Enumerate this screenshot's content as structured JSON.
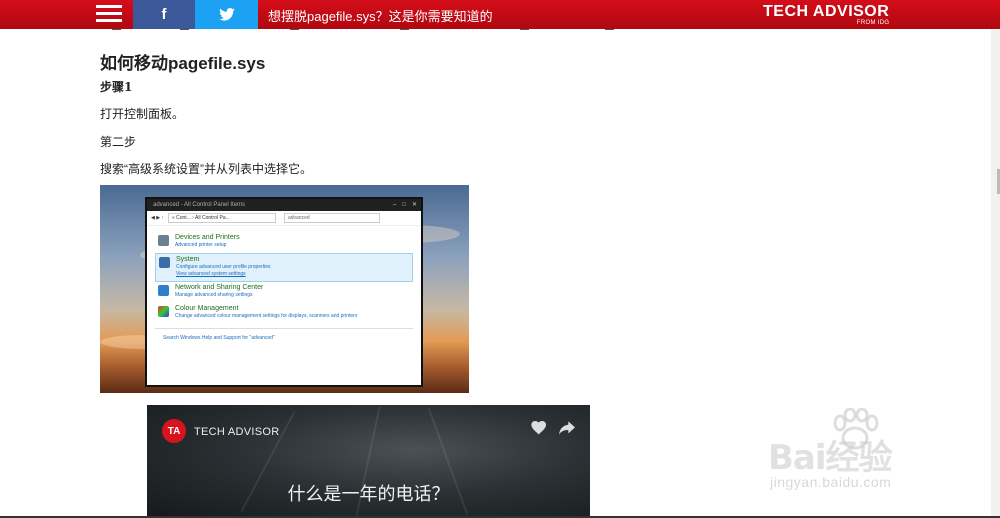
{
  "topbar": {
    "title": "想摆脱pagefile.sys？这是你需要知道的",
    "logo": "TECH ADVISOR",
    "logo_sub": "FROM IDG",
    "facebook_glyph": "f",
    "colors": {
      "bar": "#c90b14",
      "facebook": "#3b5998",
      "twitter": "#1da1f2"
    }
  },
  "article": {
    "heading": "如何移动pagefile.sys",
    "step1_label": "步骤1",
    "step1_text": "打开控制面板。",
    "step2_label": "第二步",
    "step2_text": "搜索“高级系统设置”并从列表中选择它。"
  },
  "embedded_window": {
    "title": "advanced - All Control Panel Items",
    "address": "« Cont... › All Control Pa...",
    "search_value": "advanced",
    "items": [
      {
        "name": "Devices and Printers",
        "desc": "Advanced printer setup",
        "icon": "printer-icon"
      },
      {
        "name": "System",
        "desc": "Configure advanced user profile properties",
        "link": "View advanced system settings",
        "icon": "computer-icon"
      },
      {
        "name": "Network and Sharing Center",
        "desc": "Manage advanced sharing settings",
        "icon": "network-icon"
      },
      {
        "name": "Colour Management",
        "desc": "Change advanced colour management settings for displays, scanners and printers",
        "icon": "colour-icon"
      }
    ],
    "help": "Search Windows Help and Support for \"advanced\""
  },
  "video": {
    "logo_initials": "TA",
    "brand": "TECH ADVISOR",
    "caption": "什么是一年的电话？"
  },
  "watermark": {
    "main": "Bai经验",
    "sub": "jingyan.baidu.com"
  }
}
